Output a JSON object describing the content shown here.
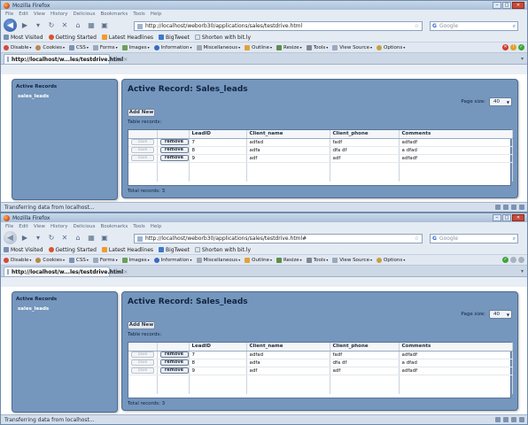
{
  "windows": [
    {
      "title": "Mozilla Firefox",
      "menu": [
        "File",
        "Edit",
        "View",
        "History",
        "Delicious",
        "Bookmarks",
        "Tools",
        "Help"
      ],
      "url": "http://localhost/weborb30/applications/sales/testdrive.html",
      "search_placeholder": "Google",
      "bookmarks": [
        "Most Visited",
        "Getting Started",
        "Latest Headlines",
        "BigTweet",
        "Shorten with bit.ly"
      ],
      "devtools": [
        "Disable",
        "Cookies",
        "CSS",
        "Forms",
        "Images",
        "Information",
        "Miscellaneous",
        "Outline",
        "Resize",
        "Tools",
        "View Source",
        "Options"
      ],
      "tab_title": "http://localhost/w...les/testdrive.html",
      "status": "Transferring data from localhost..."
    },
    {
      "title": "Mozilla Firefox",
      "menu": [
        "File",
        "Edit",
        "View",
        "History",
        "Delicious",
        "Bookmarks",
        "Tools",
        "Help"
      ],
      "url": "http://localhost/weborb30/applications/sales/testdrive.html#",
      "search_placeholder": "Google",
      "bookmarks": [
        "Most Visited",
        "Getting Started",
        "Latest Headlines",
        "BigTweet",
        "Shorten with bit.ly"
      ],
      "devtools": [
        "Disable",
        "Cookies",
        "CSS",
        "Forms",
        "Images",
        "Information",
        "Miscellaneous",
        "Outline",
        "Resize",
        "Tools",
        "View Source",
        "Options"
      ],
      "tab_title": "http://localhost/w...les/testdrive.html",
      "status": "Transferring data from localhost..."
    }
  ],
  "app": {
    "side_header": "Active Records",
    "side_item": "sales_leads",
    "main_title": "Active Record:  Sales_leads",
    "page_size_label": "Page size:",
    "page_size_value": "40",
    "add_label": "Add New",
    "table_records_label": "Table records:",
    "columns": [
      "LeadID",
      "Client_name",
      "Client_phone",
      "Comments"
    ],
    "save_label": "save",
    "remove_label": "remove",
    "rows": [
      {
        "id": "7",
        "name": "adfad",
        "phone": "fadf",
        "comments": "adfadf"
      },
      {
        "id": "8",
        "name": "adfa",
        "phone": "dfa df",
        "comments": "a dfad"
      },
      {
        "id": "9",
        "name": "adf",
        "phone": "adf",
        "comments": "adfadf"
      }
    ],
    "total_records": "Total records: 3"
  },
  "colors": {
    "panel": "#7596bd",
    "panel_border": "#4c6a90",
    "chrome": "#e4ebf3"
  }
}
